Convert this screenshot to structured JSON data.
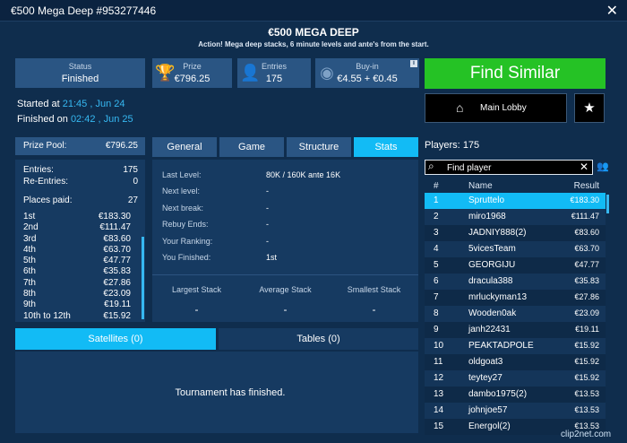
{
  "window": {
    "title": "€500 Mega Deep #953277446"
  },
  "header": {
    "title": "€500 MEGA DEEP",
    "subtitle": "Action! Mega deep stacks, 6 minute levels and ante's from the start."
  },
  "cards": {
    "status": {
      "label": "Status",
      "value": "Finished"
    },
    "prize": {
      "label": "Prize",
      "value": "€796.25"
    },
    "entries": {
      "label": "Entries",
      "value": "175"
    },
    "buyin": {
      "label": "Buy-in",
      "value": "€4.55 + €0.45",
      "info": "i"
    }
  },
  "times": {
    "started_label": "Started at",
    "started_value": "21:45 , Jun 24",
    "finished_label": "Finished on",
    "finished_value": "02:42 , Jun 25"
  },
  "buttons": {
    "find_similar": "Find Similar",
    "main_lobby": "Main Lobby"
  },
  "left": {
    "prize_pool_label": "Prize Pool:",
    "prize_pool_value": "€796.25",
    "entries_label": "Entries:",
    "entries_value": "175",
    "reentries_label": "Re-Entries:",
    "reentries_value": "0",
    "places_paid_label": "Places paid:",
    "places_paid_value": "27",
    "places": [
      {
        "place": "1st",
        "amount": "€183.30"
      },
      {
        "place": "2nd",
        "amount": "€111.47"
      },
      {
        "place": "3rd",
        "amount": "€83.60"
      },
      {
        "place": "4th",
        "amount": "€63.70"
      },
      {
        "place": "5th",
        "amount": "€47.77"
      },
      {
        "place": "6th",
        "amount": "€35.83"
      },
      {
        "place": "7th",
        "amount": "€27.86"
      },
      {
        "place": "8th",
        "amount": "€23.09"
      },
      {
        "place": "9th",
        "amount": "€19.11"
      },
      {
        "place": "10th to 12th",
        "amount": "€15.92"
      }
    ]
  },
  "tabs": {
    "general": "General",
    "game": "Game",
    "structure": "Structure",
    "stats": "Stats"
  },
  "stats": {
    "last_level_label": "Last Level:",
    "last_level_value": "80K / 160K ante 16K",
    "next_level_label": "Next level:",
    "next_level_value": "-",
    "next_break_label": "Next break:",
    "next_break_value": "-",
    "rebuy_ends_label": "Rebuy Ends:",
    "rebuy_ends_value": "-",
    "ranking_label": "Your Ranking:",
    "ranking_value": "-",
    "finished_label": "You Finished:",
    "finished_value": "1st",
    "largest_label": "Largest Stack",
    "largest_value": "-",
    "average_label": "Average Stack",
    "average_value": "-",
    "smallest_label": "Smallest Stack",
    "smallest_value": "-"
  },
  "bottom": {
    "satellites": "Satellites (0)",
    "tables": "Tables (0)",
    "message": "Tournament has finished."
  },
  "players": {
    "label": "Players:",
    "count": "175",
    "search_placeholder": "Find player",
    "col_num": "#",
    "col_name": "Name",
    "col_result": "Result",
    "rows": [
      {
        "num": "1",
        "name": "Spruttelo",
        "result": "€183.30"
      },
      {
        "num": "2",
        "name": "miro1968",
        "result": "€111.47"
      },
      {
        "num": "3",
        "name": "JADNIY888(2)",
        "result": "€83.60"
      },
      {
        "num": "4",
        "name": "5vicesTeam",
        "result": "€63.70"
      },
      {
        "num": "5",
        "name": "GEORGIJU",
        "result": "€47.77"
      },
      {
        "num": "6",
        "name": "dracula388",
        "result": "€35.83"
      },
      {
        "num": "7",
        "name": "mrluckyman13",
        "result": "€27.86"
      },
      {
        "num": "8",
        "name": "Wooden0ak",
        "result": "€23.09"
      },
      {
        "num": "9",
        "name": "janh22431",
        "result": "€19.11"
      },
      {
        "num": "10",
        "name": "PEAKTADPOLE",
        "result": "€15.92"
      },
      {
        "num": "11",
        "name": "oldgoat3",
        "result": "€15.92"
      },
      {
        "num": "12",
        "name": "teytey27",
        "result": "€15.92"
      },
      {
        "num": "13",
        "name": "dambo1975(2)",
        "result": "€13.53"
      },
      {
        "num": "14",
        "name": "johnjoe57",
        "result": "€13.53"
      },
      {
        "num": "15",
        "name": "Energol(2)",
        "result": "€13.53"
      }
    ]
  },
  "watermark": "clip2net.com",
  "colors": {
    "bg": "#0f2d4d",
    "panel": "#163a61",
    "card": "#2a5583",
    "accent": "#12bbf5",
    "green": "#25c225"
  },
  "icons": [
    "close-icon",
    "trophy-icon",
    "user-icon",
    "chip-icon",
    "info-icon",
    "home-icon",
    "star-icon",
    "search-icon",
    "clear-icon",
    "players-icon"
  ]
}
